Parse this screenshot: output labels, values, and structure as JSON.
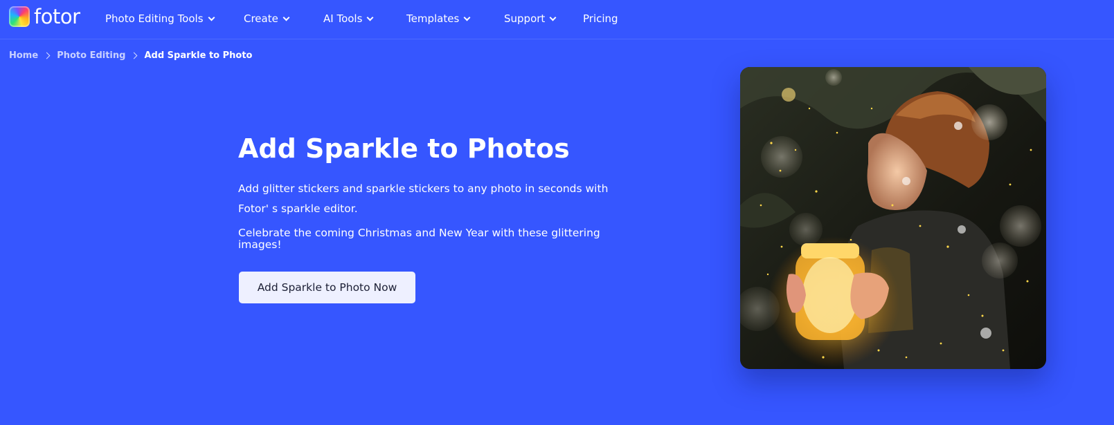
{
  "header": {
    "logo_text": "fotor",
    "nav": [
      {
        "label": "Photo Editing Tools",
        "has_dropdown": true
      },
      {
        "label": "Create",
        "has_dropdown": true
      },
      {
        "label": "AI Tools",
        "has_dropdown": true
      },
      {
        "label": "Templates",
        "has_dropdown": true
      },
      {
        "label": "Support",
        "has_dropdown": true
      },
      {
        "label": "Pricing",
        "has_dropdown": false
      }
    ]
  },
  "breadcrumb": {
    "items": [
      "Home",
      "Photo Editing"
    ],
    "current": "Add Sparkle to Photo"
  },
  "hero": {
    "title": "Add Sparkle to Photos",
    "description": "Add glitter stickers and sparkle stickers to any photo in seconds with Fotor' s sparkle editor.",
    "note": "Celebrate the coming Christmas and New Year with these glittering images!",
    "cta_label": "Add Sparkle to Photo Now"
  },
  "colors": {
    "background": "#3656ff",
    "cta_background": "#eef0ff",
    "cta_text": "#1c1f35"
  },
  "icons": {
    "logo": "fotor-logo-icon",
    "dropdown": "chevron-down-icon",
    "breadcrumb_separator": "chevron-right-icon"
  }
}
